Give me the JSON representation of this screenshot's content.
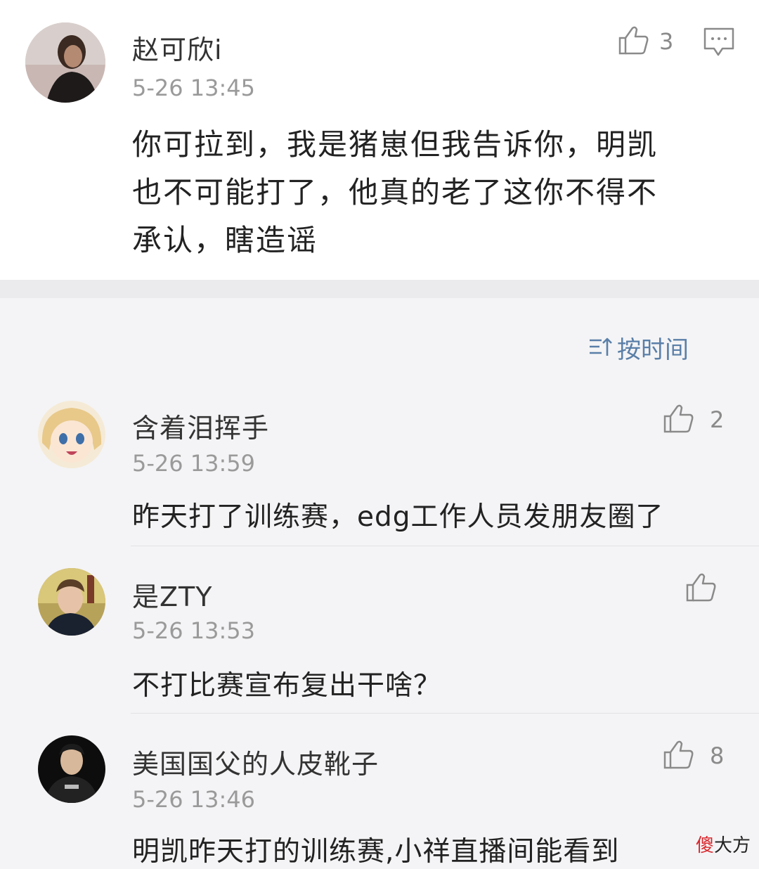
{
  "main_comment": {
    "username": "赵可欣i",
    "time": "5-26 13:45",
    "likes": "3",
    "text_lines": [
      "你可拉到，我是猪崽但我告诉你，明凯",
      "也不可能打了，他真的老了这你不得不",
      "承认，瞎造谣"
    ]
  },
  "sort": {
    "label": "按时间"
  },
  "replies": [
    {
      "username": "含着泪挥手",
      "time": "5-26 13:59",
      "likes": "2",
      "text": "昨天打了训练赛，edg工作人员发朋友圈了"
    },
    {
      "username": "是ZTY",
      "time": "5-26 13:53",
      "likes": "",
      "text": "不打比赛宣布复出干啥？"
    },
    {
      "username": "美国国父的人皮靴子",
      "time": "5-26 13:46",
      "likes": "8",
      "text": "明凯昨天打的训练赛,小祥直播间能看到"
    }
  ],
  "watermark": {
    "accent": "傻",
    "rest": "大方"
  },
  "colors": {
    "link_blue": "#5a7fa8",
    "muted_gray": "#9a9a9a",
    "watermark_red": "#d8262c"
  }
}
